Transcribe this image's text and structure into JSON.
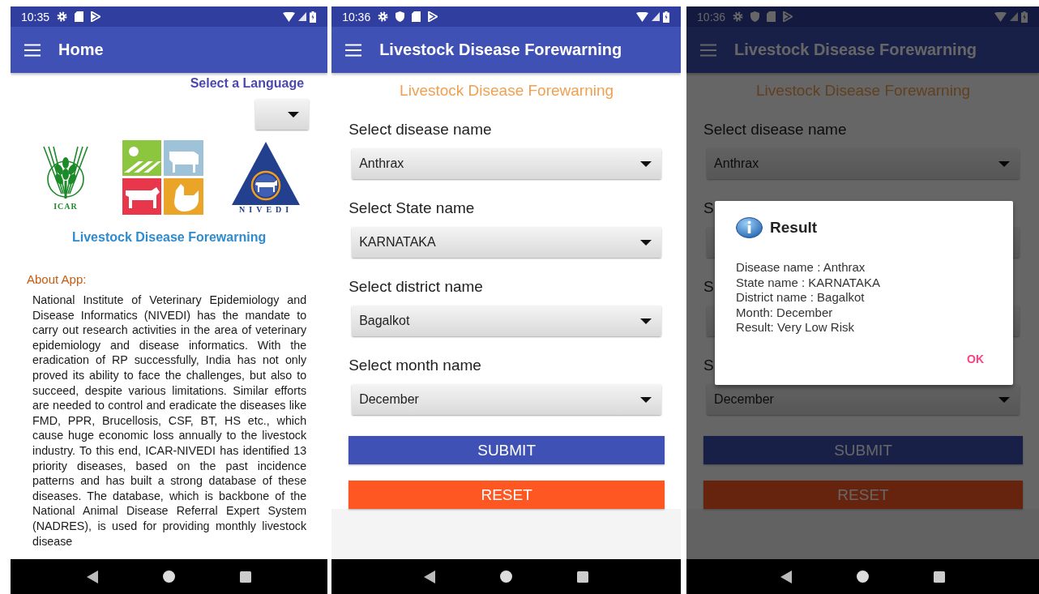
{
  "screens": [
    {
      "kind": "home",
      "dimmed": false,
      "status_bar": {
        "time": "10:35",
        "notifications": [
          {
            "kind": "gear"
          },
          {
            "kind": "card"
          },
          {
            "kind": "play"
          }
        ]
      },
      "app_bar": {
        "title": "Home"
      },
      "language": {
        "label": "Select a Language"
      },
      "logos": [
        {
          "kind": "icar",
          "caption": "ICAR"
        },
        {
          "kind": "tiles"
        },
        {
          "kind": "nivedi",
          "caption": "NIVEDI"
        }
      ],
      "app_name": "Livestock Disease Forewarning",
      "about": {
        "heading": "About App:",
        "text": "National Institute of Veterinary Epidemiology and Disease Informatics (NIVEDI) has the mandate to carry out research activities in the area of veterinary epidemiology and disease informatics. With the eradication of RP successfully, India has not only proved its ability to face the challenges, but also to succeed, despite various limitations. Similar efforts are needed to control and eradicate the diseases like FMD, PPR, Brucellosis, CSF, BT, HS etc., which cause huge economic loss annually to the livestock industry. To this end, ICAR-NIVEDI has identified 13 priority diseases, based on the past incidence patterns and has built a strong database of these diseases. The database, which is backbone of the National Animal Disease Referral Expert System (NADRES), is used for providing monthly livestock disease"
      }
    },
    {
      "kind": "form",
      "dimmed": false,
      "status_bar": {
        "time": "10:36",
        "notifications": [
          {
            "kind": "gear"
          },
          {
            "kind": "shield"
          },
          {
            "kind": "card"
          },
          {
            "kind": "play"
          }
        ]
      },
      "app_bar": {
        "title": "Livestock Disease Forewarning"
      },
      "heading": "Livestock Disease Forewarning",
      "fields": [
        {
          "label": "Select disease name",
          "value": "Anthrax"
        },
        {
          "label": "Select State name",
          "value": "KARNATAKA"
        },
        {
          "label": "Select district name",
          "value": "Bagalkot"
        },
        {
          "label": "Select month name",
          "value": "December"
        }
      ],
      "buttons": [
        {
          "kind": "submit",
          "label": "SUBMIT"
        },
        {
          "kind": "reset",
          "label": "RESET"
        }
      ]
    },
    {
      "kind": "form",
      "dimmed": true,
      "status_bar": {
        "time": "10:36",
        "notifications": [
          {
            "kind": "gear"
          },
          {
            "kind": "shield"
          },
          {
            "kind": "card"
          },
          {
            "kind": "play"
          }
        ]
      },
      "app_bar": {
        "title": "Livestock Disease Forewarning"
      },
      "heading": "Livestock Disease Forewarning",
      "fields": [
        {
          "label": "Select disease name",
          "value": "Anthrax"
        },
        {
          "label": "S"
        },
        {
          "label": "S"
        },
        {
          "label": "S",
          "value": "December"
        }
      ],
      "buttons": [
        {
          "kind": "submit",
          "label": "SUBMIT"
        },
        {
          "kind": "reset",
          "label": "RESET"
        }
      ],
      "dialog": {
        "title": "Result",
        "lines": [
          "Disease name : Anthrax",
          "State name : KARNATAKA",
          "District name : Bagalkot",
          "Month: December",
          "Result: Very Low Risk"
        ],
        "action": "OK"
      }
    }
  ]
}
